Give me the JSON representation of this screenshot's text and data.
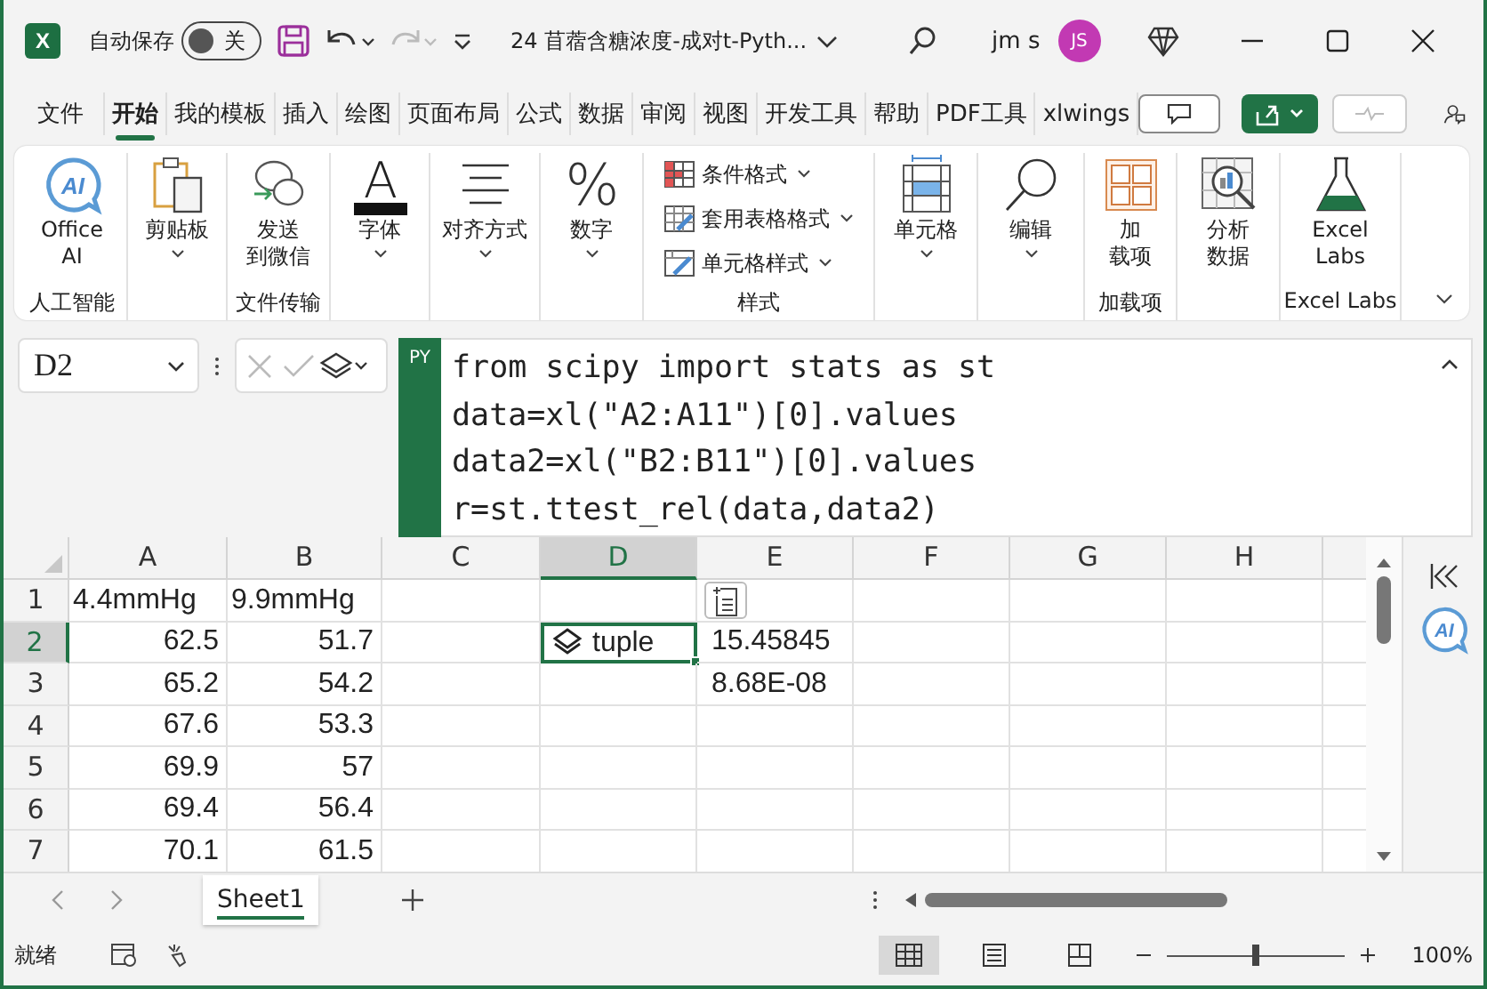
{
  "title_bar": {
    "logo_text": "X",
    "autosave_label": "自动保存",
    "autosave": {
      "on": false,
      "label": "关"
    },
    "redo_disabled": true,
    "document_title": "24 苜蓿含糖浓度-成对t-Pyth...",
    "user_name": "jm s",
    "avatar_initials": "JS"
  },
  "menu_tabs": [
    {
      "label": "文件",
      "selected": false
    },
    {
      "label": "开始",
      "selected": true
    },
    {
      "label": "我的模板",
      "selected": false
    },
    {
      "label": "插入",
      "selected": false
    },
    {
      "label": "绘图",
      "selected": false
    },
    {
      "label": "页面布局",
      "selected": false
    },
    {
      "label": "公式",
      "selected": false
    },
    {
      "label": "数据",
      "selected": false
    },
    {
      "label": "审阅",
      "selected": false
    },
    {
      "label": "视图",
      "selected": false
    },
    {
      "label": "开发工具",
      "selected": false
    },
    {
      "label": "帮助",
      "selected": false
    },
    {
      "label": "PDF工具",
      "selected": false
    },
    {
      "label": "xlwings",
      "selected": false
    }
  ],
  "ribbon": {
    "groups": [
      {
        "label": "人工智能",
        "buttons": [
          {
            "kind": "large",
            "lines": [
              "Office",
              "AI"
            ],
            "icon_text": "AI",
            "dropdown": false
          }
        ]
      },
      {
        "buttons": [
          {
            "kind": "large",
            "lines": [
              "剪贴板"
            ],
            "dropdown": true
          }
        ]
      },
      {
        "label": "文件传输",
        "buttons": [
          {
            "kind": "large",
            "lines": [
              "发送",
              "到微信"
            ],
            "dropdown": false
          }
        ]
      },
      {
        "buttons": [
          {
            "kind": "large",
            "lines": [
              "字体"
            ],
            "icon_text": "A",
            "dropdown": true
          }
        ]
      },
      {
        "buttons": [
          {
            "kind": "large",
            "lines": [
              "对齐方式"
            ],
            "dropdown": true
          }
        ]
      },
      {
        "buttons": [
          {
            "kind": "large",
            "lines": [
              "数字"
            ],
            "icon_text": "%",
            "dropdown": true
          }
        ]
      },
      {
        "label": "样式",
        "buttons": [
          {
            "kind": "small",
            "lines": [
              "条件格式"
            ],
            "dropdown": true
          },
          {
            "kind": "small",
            "lines": [
              "套用表格格式"
            ],
            "dropdown": true
          },
          {
            "kind": "small",
            "lines": [
              "单元格样式"
            ],
            "dropdown": true
          }
        ]
      },
      {
        "buttons": [
          {
            "kind": "large",
            "lines": [
              "单元格"
            ],
            "dropdown": true
          }
        ]
      },
      {
        "buttons": [
          {
            "kind": "large",
            "lines": [
              "编辑"
            ],
            "dropdown": true
          }
        ]
      },
      {
        "label": "加载项",
        "buttons": [
          {
            "kind": "large",
            "lines": [
              "加",
              "载项"
            ],
            "dropdown": false
          }
        ]
      },
      {
        "buttons": [
          {
            "kind": "large",
            "lines": [
              "分析",
              "数据"
            ],
            "dropdown": false
          }
        ]
      },
      {
        "label": "Excel Labs",
        "buttons": [
          {
            "kind": "large",
            "lines": [
              "Excel",
              "Labs"
            ],
            "dropdown": false
          }
        ]
      }
    ]
  },
  "formula_bar": {
    "name_box": "D2",
    "badge": "PY",
    "code_lines": [
      "from scipy import stats as st",
      "data=xl(\"A2:A11\")[0].values",
      "data2=xl(\"B2:B11\")[0].values",
      "r=st.ttest_rel(data,data2)"
    ]
  },
  "sheet": {
    "columns": [
      {
        "label": "A",
        "selected": false
      },
      {
        "label": "B",
        "selected": false
      },
      {
        "label": "C",
        "selected": false
      },
      {
        "label": "D",
        "selected": true
      },
      {
        "label": "E",
        "selected": false
      },
      {
        "label": "F",
        "selected": false
      },
      {
        "label": "G",
        "selected": false
      },
      {
        "label": "H",
        "selected": false
      }
    ],
    "rows": [
      {
        "label": "1",
        "selected": false,
        "cells": [
          {
            "kind": "text",
            "text": "4.4mmHg",
            "selected": false
          },
          {
            "kind": "text",
            "text": "9.9mmHg",
            "selected": false
          }
        ]
      },
      {
        "label": "2",
        "selected": true,
        "cells": [
          {
            "kind": "number",
            "text": "62.5",
            "selected": false
          },
          {
            "kind": "number",
            "text": "51.7",
            "selected": false
          },
          {
            "kind": "empty",
            "selected": false
          },
          {
            "kind": "object",
            "text": "tuple",
            "selected": true
          },
          {
            "kind": "value",
            "text": "15.45845",
            "selected": false
          }
        ]
      },
      {
        "label": "3",
        "selected": false,
        "cells": [
          {
            "kind": "number",
            "text": "65.2",
            "selected": false
          },
          {
            "kind": "number",
            "text": "54.2",
            "selected": false
          },
          {
            "kind": "empty",
            "selected": false
          },
          {
            "kind": "empty",
            "selected": false
          },
          {
            "kind": "value",
            "text": "8.68E-08",
            "selected": false
          }
        ]
      },
      {
        "label": "4",
        "selected": false,
        "cells": [
          {
            "kind": "number",
            "text": "67.6",
            "selected": false
          },
          {
            "kind": "number",
            "text": "53.3",
            "selected": false
          }
        ]
      },
      {
        "label": "5",
        "selected": false,
        "cells": [
          {
            "kind": "number",
            "text": "69.9",
            "selected": false
          },
          {
            "kind": "number",
            "text": "57",
            "selected": false
          }
        ]
      },
      {
        "label": "6",
        "selected": false,
        "cells": [
          {
            "kind": "number",
            "text": "69.4",
            "selected": false
          },
          {
            "kind": "number",
            "text": "56.4",
            "selected": false
          }
        ]
      },
      {
        "label": "7",
        "selected": false,
        "cells": [
          {
            "kind": "number",
            "text": "70.1",
            "selected": false
          },
          {
            "kind": "number",
            "text": "61.5",
            "selected": false
          }
        ]
      }
    ]
  },
  "side_pane": {
    "ai_text": "AI"
  },
  "sheet_tabs": [
    {
      "label": "Sheet1",
      "selected": true
    }
  ],
  "status_bar": {
    "status": "就绪",
    "views": [
      {
        "selected": true
      },
      {
        "selected": false
      },
      {
        "selected": false
      }
    ],
    "zoom": {
      "level": 0.5,
      "label": "100%"
    }
  }
}
